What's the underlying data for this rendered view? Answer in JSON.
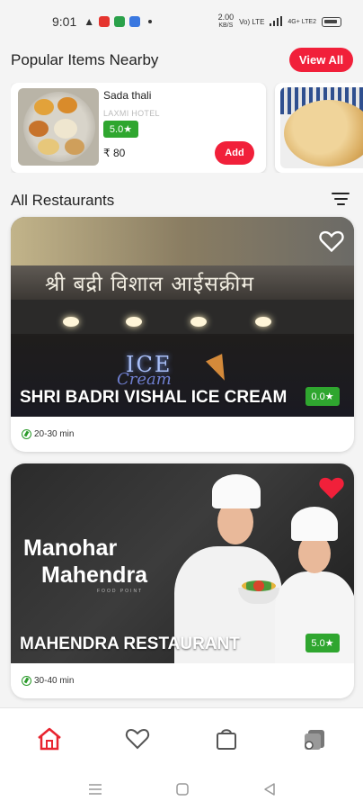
{
  "status_bar": {
    "time": "9:01",
    "speed_top": "2.00",
    "speed_bottom": "KB/S",
    "network": "Vo) LTE",
    "signal": "4G+ LTE2"
  },
  "popular": {
    "title": "Popular Items Nearby",
    "view_all_label": "View All",
    "items": [
      {
        "name": "Sada thali",
        "hotel": "LAXMI HOTEL",
        "rating": "5.0★",
        "price": "₹ 80",
        "add_label": "Add"
      }
    ]
  },
  "restaurants": {
    "title": "All Restaurants",
    "items": [
      {
        "name": "SHRI BADRI VISHAL ICE CREAM",
        "rating": "0.0★",
        "time": "20-30 min",
        "sign_text": "श्री बद्री विशाल आईसक्रीम",
        "neon_1": "ICE",
        "neon_2": "Cream",
        "favorited": false
      },
      {
        "name": "MAHENDRA RESTAURANT",
        "rating": "5.0★",
        "time": "30-40 min",
        "brand_line_1": "Manohar",
        "brand_line_2": "Mahendra",
        "brand_line_3": "FOOD POINT",
        "favorited": true
      }
    ]
  },
  "nav": {
    "items": [
      "home-icon",
      "favorites-icon",
      "bag-icon",
      "profile-wallet-icon"
    ],
    "active": "home",
    "active_color": "#e8242f"
  },
  "colors": {
    "accent": "#f1203a",
    "rating_green": "#2fa62f"
  }
}
